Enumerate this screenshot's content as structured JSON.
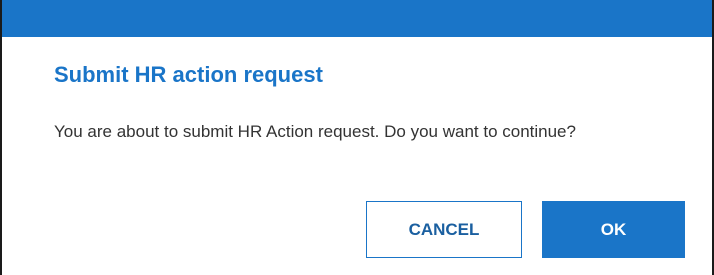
{
  "dialog": {
    "title": "Submit HR action request",
    "message": "You are about to submit HR Action request. Do you want to continue?",
    "buttons": {
      "cancel_label": "CANCEL",
      "ok_label": "OK"
    }
  },
  "colors": {
    "accent": "#1a75c8",
    "text": "#333333",
    "background": "#ffffff"
  }
}
